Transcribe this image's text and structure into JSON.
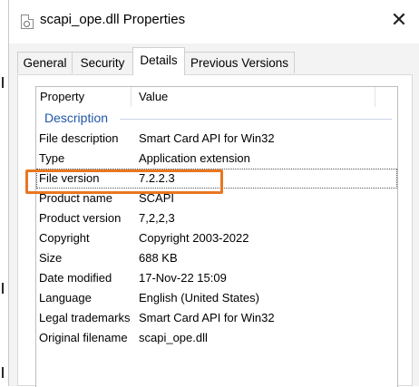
{
  "window": {
    "title": "scapi_ope.dll Properties",
    "close_symbol": "✕",
    "file_icon": "dll-file-icon"
  },
  "tabs": [
    {
      "label": "General",
      "active": false
    },
    {
      "label": "Security",
      "active": false
    },
    {
      "label": "Details",
      "active": true
    },
    {
      "label": "Previous Versions",
      "active": false
    }
  ],
  "details": {
    "header": {
      "property": "Property",
      "value": "Value"
    },
    "group_label": "Description",
    "rows": [
      {
        "property": "File description",
        "value": "Smart Card API for Win32"
      },
      {
        "property": "Type",
        "value": "Application extension"
      },
      {
        "property": "File version",
        "value": "7.2.2.3"
      },
      {
        "property": "Product name",
        "value": "SCAPI"
      },
      {
        "property": "Product version",
        "value": "7,2,2,3"
      },
      {
        "property": "Copyright",
        "value": "Copyright 2003-2022"
      },
      {
        "property": "Size",
        "value": "688 KB"
      },
      {
        "property": "Date modified",
        "value": "17-Nov-22 15:09"
      },
      {
        "property": "Language",
        "value": "English (United States)"
      },
      {
        "property": "Legal trademarks",
        "value": "Smart Card API for Win32"
      },
      {
        "property": "Original filename",
        "value": "scapi_ope.dll"
      }
    ]
  },
  "colors": {
    "highlight": "#e87722",
    "group_label": "#1f57a8"
  }
}
